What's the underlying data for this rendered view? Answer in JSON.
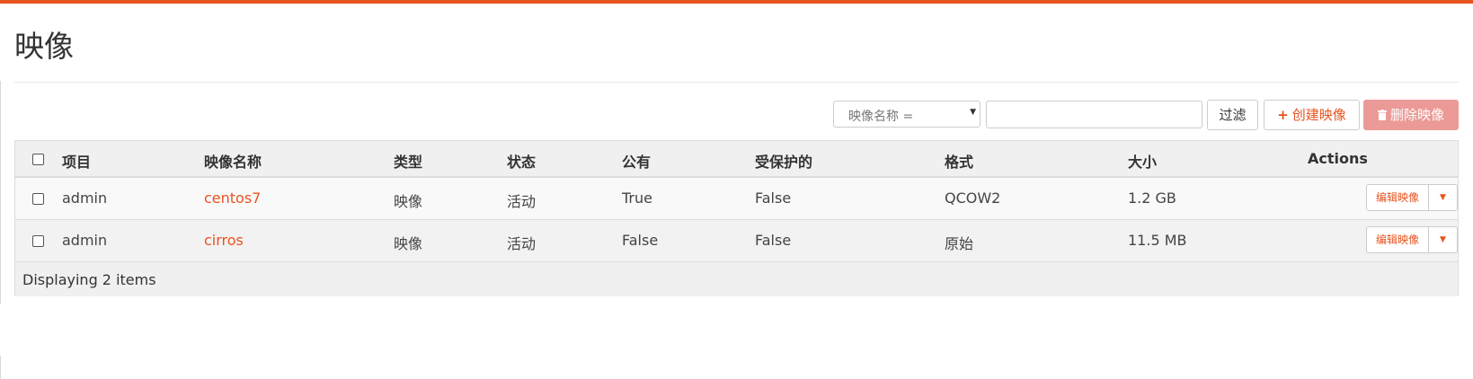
{
  "page": {
    "title": "映像"
  },
  "toolbar": {
    "filter_field_label": "映像名称 =",
    "search_value": "",
    "filter_button": "过滤",
    "create_button": "创建映像",
    "delete_button": "删除映像"
  },
  "table": {
    "columns": [
      "项目",
      "映像名称",
      "类型",
      "状态",
      "公有",
      "受保护的",
      "格式",
      "大小",
      "Actions"
    ],
    "rows": [
      {
        "project": "admin",
        "name": "centos7",
        "type": "映像",
        "status": "活动",
        "public": "True",
        "protected": "False",
        "format": "QCOW2",
        "size": "1.2 GB",
        "edit_label": "编辑映像"
      },
      {
        "project": "admin",
        "name": "cirros",
        "type": "映像",
        "status": "活动",
        "public": "False",
        "protected": "False",
        "format": "原始",
        "size": "11.5 MB",
        "edit_label": "编辑映像"
      }
    ],
    "footer": "Displaying 2 items"
  },
  "colors": {
    "accent": "#e8531f",
    "danger_disabled": "#eb9a97"
  },
  "icons": [
    "plus-icon",
    "trash-icon",
    "caret-down-icon",
    "checkbox"
  ]
}
